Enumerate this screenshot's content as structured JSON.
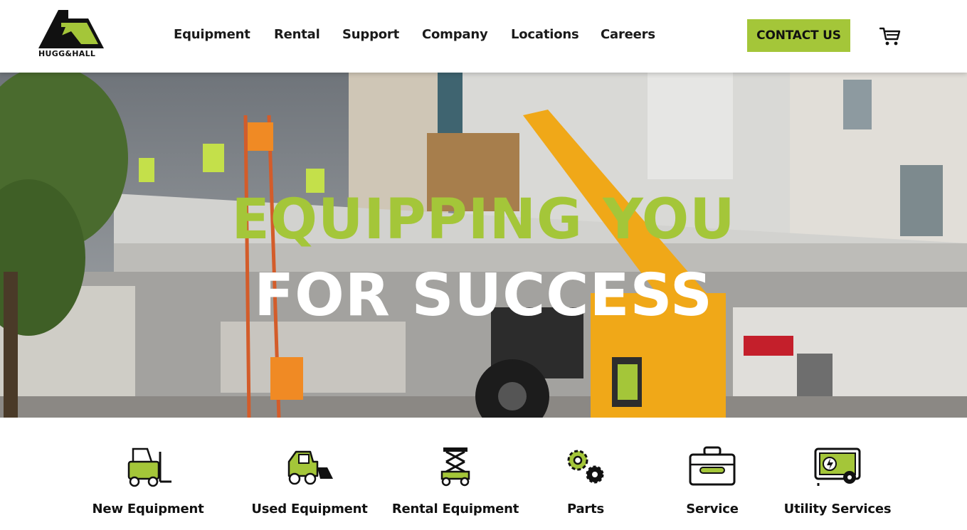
{
  "brand": {
    "name": "HUGG&HALL",
    "accent": "#a4c639"
  },
  "nav": {
    "items": [
      {
        "label": "Equipment"
      },
      {
        "label": "Rental"
      },
      {
        "label": "Support"
      },
      {
        "label": "Company"
      },
      {
        "label": "Locations"
      },
      {
        "label": "Careers"
      }
    ],
    "contact_label": "CONTACT US",
    "cart_icon": "cart-icon"
  },
  "hero": {
    "line1": "EQUIPPING YOU",
    "line2": "FOR SUCCESS"
  },
  "categories": [
    {
      "label": "New Equipment",
      "icon": "forklift-icon"
    },
    {
      "label": "Used Equipment",
      "icon": "skid-steer-icon"
    },
    {
      "label": "Rental Equipment",
      "icon": "scissor-lift-icon"
    },
    {
      "label": "Parts",
      "icon": "gears-icon"
    },
    {
      "label": "Service",
      "icon": "toolbox-icon"
    },
    {
      "label": "Utility Services",
      "icon": "generator-icon"
    }
  ]
}
